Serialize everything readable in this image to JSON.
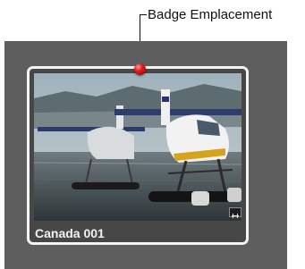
{
  "callout": {
    "label": "Badge Emplacement"
  },
  "thumbnail": {
    "title": "Canada 001",
    "badge_icon": "filmstrip-badge-icon",
    "colors": {
      "frame": "#f4f4f4",
      "tile": "#474747",
      "canvas": "#5e5e5e",
      "badge_dot": "#e02020"
    }
  }
}
